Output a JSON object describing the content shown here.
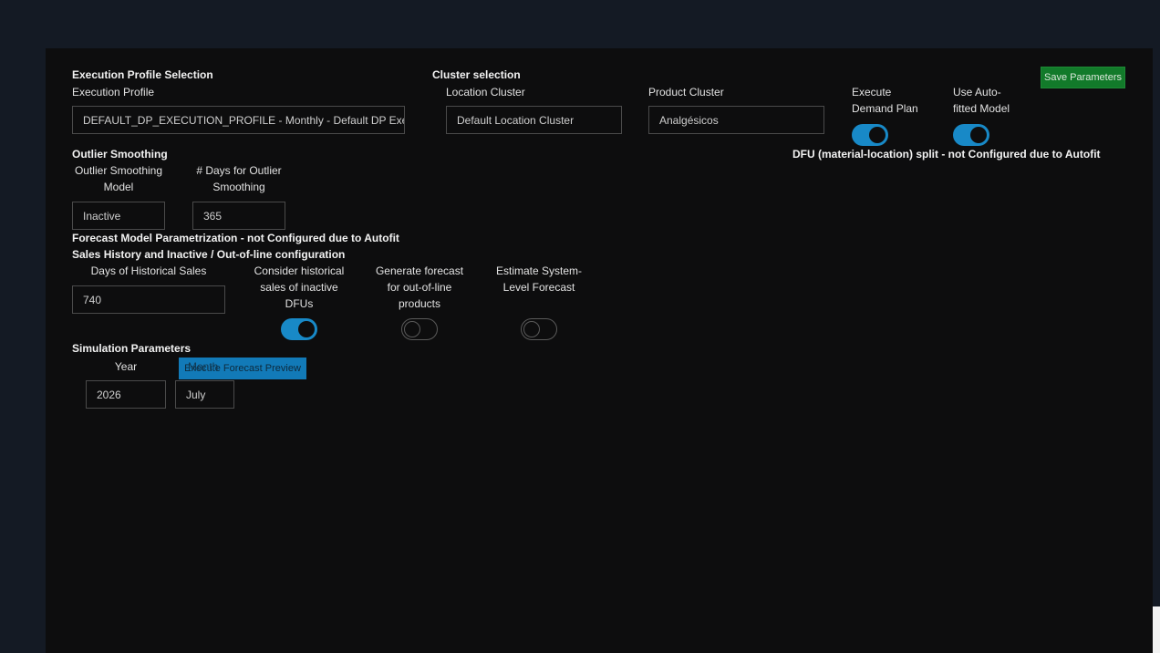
{
  "colors": {
    "accent": "#1889c7",
    "save": "#127a2a",
    "panel": "#0d0d0e",
    "background": "#141a24"
  },
  "toolbar": {
    "save_label": "Save Parameters"
  },
  "execution_profile": {
    "section_title": "Execution Profile Selection",
    "label": "Execution Profile",
    "value": "DEFAULT_DP_EXECUTION_PROFILE - Monthly - Default DP Execu"
  },
  "cluster": {
    "section_title": "Cluster selection",
    "location_label": "Location Cluster",
    "location_value": "Default Location Cluster",
    "product_label": "Product Cluster",
    "product_value": "Analgésicos"
  },
  "execute_demand_plan": {
    "label_1": "Execute",
    "label_2": "Demand Plan",
    "on": true
  },
  "autofit": {
    "label_1": "Use Auto-",
    "label_2": "fitted Model",
    "on": true
  },
  "dfu_split_note": "DFU (material-location) split - not Configured due to Autofit",
  "outlier": {
    "section_title": "Outlier Smoothing",
    "model_label_1": "Outlier Smoothing",
    "model_label_2": "Model",
    "model_value": "Inactive",
    "days_label_1": "# Days for Outlier",
    "days_label_2": "Smoothing",
    "days_value": "365"
  },
  "forecast_param_note": "Forecast Model Parametrization - not Configured due to Autofit",
  "sales_history": {
    "section_title": "Sales History and Inactive / Out-of-line configuration",
    "days_label": "Days of Historical Sales",
    "days_value": "740",
    "inactive_label_1": "Consider historical",
    "inactive_label_2": "sales of inactive",
    "inactive_label_3": "DFUs",
    "inactive_on": true,
    "outofline_label_1": "Generate forecast",
    "outofline_label_2": "for out-of-line",
    "outofline_label_3": "products",
    "outofline_on": false,
    "system_label_1": "Estimate System-",
    "system_label_2": "Level Forecast",
    "system_on": false
  },
  "simulation": {
    "section_title": "Simulation Parameters",
    "year_label": "Year",
    "year_value": "2026",
    "month_label": "Month",
    "month_value": "July",
    "preview_button": "Execute Forecast Preview"
  }
}
